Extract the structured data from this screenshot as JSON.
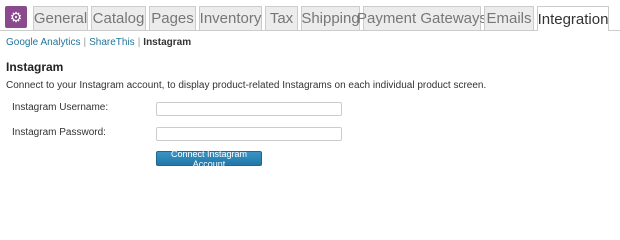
{
  "logo": {
    "icon": "gear-icon",
    "glyph": "⚙",
    "color": "#8a4a8d"
  },
  "tabs": [
    {
      "label": "General"
    },
    {
      "label": "Catalog"
    },
    {
      "label": "Pages"
    },
    {
      "label": "Inventory"
    },
    {
      "label": "Tax"
    },
    {
      "label": "Shipping"
    },
    {
      "label": "Payment Gateways"
    },
    {
      "label": "Emails"
    },
    {
      "label": "Integration"
    }
  ],
  "active_tab": "Integration",
  "subnav": {
    "links": [
      {
        "label": "Google Analytics"
      },
      {
        "label": "ShareThis"
      }
    ],
    "separator": "|",
    "current": "Instagram"
  },
  "section": {
    "title": "Instagram",
    "description": "Connect to your Instagram account, to display product-related Instagrams on each individual product screen."
  },
  "form": {
    "username_label": "Instagram Username:",
    "username_value": "",
    "password_label": "Instagram Password:",
    "password_value": "",
    "connect_label": "Connect Instagram Account"
  },
  "colors": {
    "link": "#21759b",
    "button": "#2178a8",
    "active_tab_bg": "#ffffff",
    "tab_bg": "#ececec"
  }
}
